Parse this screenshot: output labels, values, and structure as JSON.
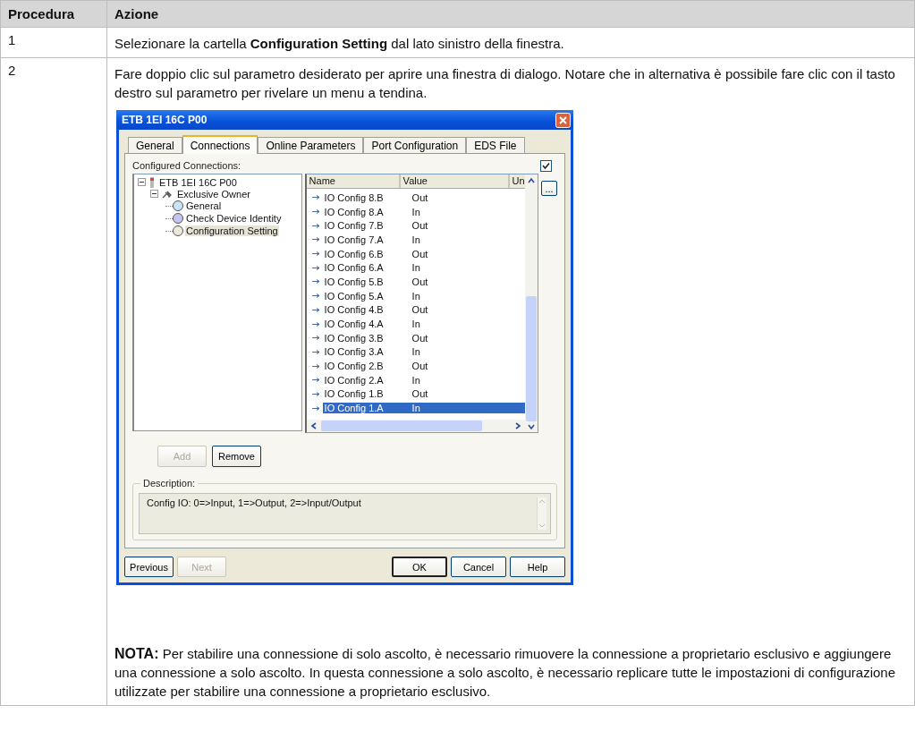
{
  "table": {
    "columns": [
      "Procedura",
      "Azione"
    ],
    "rows": [
      {
        "step": "1",
        "text": "Selezionare la cartella **Configuration Setting** dal lato sinistro della finestra."
      },
      {
        "step": "2",
        "text": "Fare doppio clic sul parametro desiderato per aprire una finestra di dialogo. Notare che in alternativa è possibile fare clic con il tasto destro sul parametro per rivelare un menu a tendina.",
        "dialog": {
          "title": "ETB 1EI 16C P00",
          "tabs": [
            {
              "label": "General",
              "selected": false
            },
            {
              "label": "Connections",
              "selected": true
            },
            {
              "label": "Online Parameters",
              "selected": false
            },
            {
              "label": "Port Configuration",
              "selected": false
            },
            {
              "label": "EDS File",
              "selected": false
            }
          ],
          "configured_connections_label": "Configured Connections:",
          "checkbox": {
            "checked": true
          },
          "tree": {
            "label": "ETB 1EI 16C P00",
            "expanded": true,
            "children": [
              {
                "label": "Exclusive Owner",
                "expanded": true,
                "children": [
                  {
                    "label": "General",
                    "color": "#c9e4f7",
                    "selected": false
                  },
                  {
                    "label": "Check Device Identity",
                    "color": "#c4c4f0",
                    "selected": false
                  },
                  {
                    "label": "Configuration Setting",
                    "color": "#ecebd9",
                    "selected": true
                  }
                ]
              }
            ]
          },
          "list": {
            "columns": [
              "Name",
              "Value",
              "Un"
            ],
            "more_button": "...",
            "rows": [
              {
                "name": "IO Config 8.B",
                "value": "Out",
                "selected": false
              },
              {
                "name": "IO Config 8.A",
                "value": "In",
                "selected": false
              },
              {
                "name": "IO Config 7.B",
                "value": "Out",
                "selected": false
              },
              {
                "name": "IO Config 7.A",
                "value": "In",
                "selected": false
              },
              {
                "name": "IO Config 6.B",
                "value": "Out",
                "selected": false
              },
              {
                "name": "IO Config 6.A",
                "value": "In",
                "selected": false
              },
              {
                "name": "IO Config 5.B",
                "value": "Out",
                "selected": false
              },
              {
                "name": "IO Config 5.A",
                "value": "In",
                "selected": false
              },
              {
                "name": "IO Config 4.B",
                "value": "Out",
                "selected": false
              },
              {
                "name": "IO Config 4.A",
                "value": "In",
                "selected": false
              },
              {
                "name": "IO Config 3.B",
                "value": "Out",
                "selected": false
              },
              {
                "name": "IO Config 3.A",
                "value": "In",
                "selected": false
              },
              {
                "name": "IO Config 2.B",
                "value": "Out",
                "selected": false
              },
              {
                "name": "IO Config 2.A",
                "value": "In",
                "selected": false
              },
              {
                "name": "IO Config 1.B",
                "value": "Out",
                "selected": false
              },
              {
                "name": "IO Config 1.A",
                "value": "In",
                "selected": true
              }
            ]
          },
          "edit_buttons": [
            {
              "label": "Add",
              "disabled": true
            },
            {
              "label": "Remove",
              "disabled": false
            }
          ],
          "description": {
            "label": "Description:",
            "text": "Config IO: 0=>Input, 1=>Output, 2=>Input/Output"
          },
          "footer_left": [
            {
              "label": "Previous",
              "disabled": false
            },
            {
              "label": "Next",
              "disabled": true
            }
          ],
          "footer_right": [
            {
              "label": "OK",
              "disabled": false,
              "default": true
            },
            {
              "label": "Cancel",
              "disabled": false,
              "default": false
            },
            {
              "label": "Help",
              "disabled": false,
              "default": false
            }
          ]
        },
        "note": {
          "label": "NOTA:",
          "text": "Per stabilire una connessione di solo ascolto, è necessario rimuovere la connessione a proprietario esclusivo e aggiungere una connessione a solo ascolto. In questa connessione a solo ascolto, è necessario replicare tutte le impostazioni di configurazione utilizzate per stabilire una connessione a proprietario esclusivo."
        }
      }
    ]
  }
}
